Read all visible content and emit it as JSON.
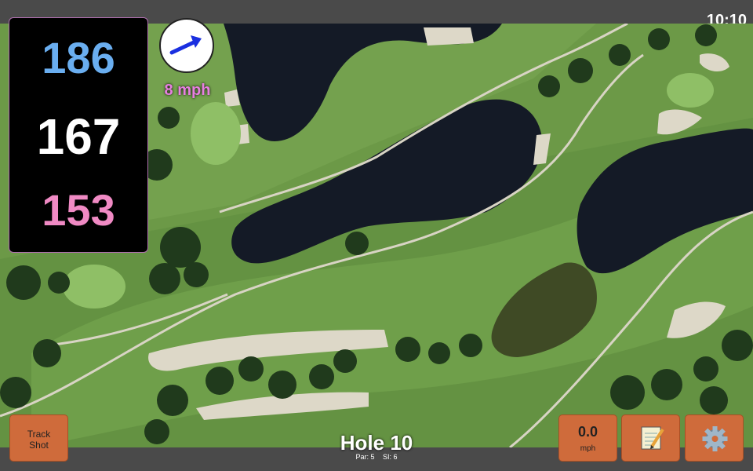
{
  "status": {
    "time": "10:10"
  },
  "distances": {
    "front": "186",
    "center": "167",
    "back": "153"
  },
  "wind": {
    "speed": "8 mph",
    "icon": "arrow-icon"
  },
  "hole": {
    "title": "Hole 10",
    "par": "Par: 5",
    "si": "SI: 6"
  },
  "buttons": {
    "track_shot": "Track Shot",
    "speed_value": "0.0",
    "speed_unit": "mph",
    "notes_icon": "notepad-icon",
    "settings_icon": "gear-icon"
  },
  "colors": {
    "front": "#6aaef0",
    "center": "#ffffff",
    "back": "#f08ac4",
    "wind_label": "#e77fe0",
    "button": "#cf6b3b",
    "arrow": "#1a2fe0"
  }
}
